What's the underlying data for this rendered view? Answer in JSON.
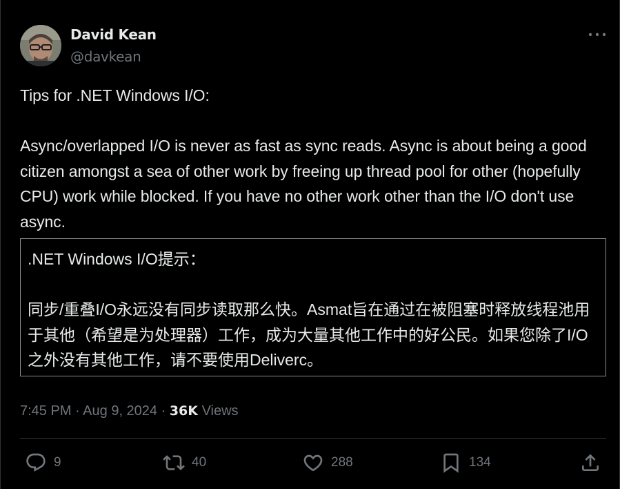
{
  "post": {
    "author_name": "David Kean",
    "author_handle": "@davkean",
    "paragraph_1": "Tips for .NET Windows I/O:",
    "paragraph_2": "Async/overlapped I/O is never as fast as sync reads. Async is about being a good citizen amongst a sea of other work by freeing up thread pool for other (hopefully CPU) work while blocked. If you have no other work other than the I/O don't use async."
  },
  "translation": {
    "line_1": ".NET Windows I/O提示：",
    "line_2": "同步/重叠I/O永远没有同步读取那么快。Asmat旨在通过在被阻塞时释放线程池用于其他（希望是为处理器）工作，成为大量其他工作中的好公民。如果您除了I/O之外没有其他工作，请不要使用Deliverc。"
  },
  "meta": {
    "time": "7:45 PM",
    "date": "Aug 9, 2024",
    "views_count": "36K",
    "views_label": "Views"
  },
  "actions": {
    "replies": "9",
    "reposts": "40",
    "likes": "288",
    "bookmarks": "134"
  },
  "icons": [
    "more-icon",
    "reply-icon",
    "repost-icon",
    "like-icon",
    "bookmark-icon",
    "share-icon"
  ],
  "colors": {
    "background": "#000000",
    "text": "#e7e9ea",
    "secondary_text": "#71767b",
    "border": "#2f3336"
  }
}
